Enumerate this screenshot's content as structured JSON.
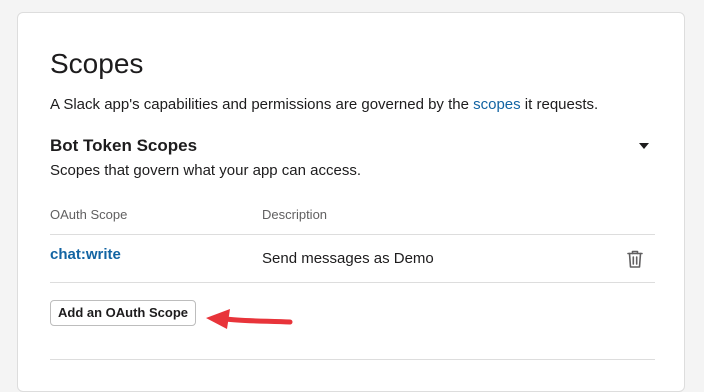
{
  "page": {
    "title": "Scopes",
    "intro_prefix": "A Slack app's capabilities and permissions are governed by the ",
    "intro_link": "scopes",
    "intro_suffix": " it requests."
  },
  "bot_scopes": {
    "title": "Bot Token Scopes",
    "description": "Scopes that govern what your app can access.",
    "toggle_icon": "caret-down-icon",
    "columns": [
      "OAuth Scope",
      "Description"
    ],
    "rows": [
      {
        "scope": "chat:write",
        "description": "Send messages as Demo",
        "action_icon": "trash-icon"
      }
    ],
    "add_button_label": "Add an OAuth Scope"
  },
  "annotation": {
    "icon": "red-arrow-icon",
    "color": "#e8343a"
  },
  "colors": {
    "link": "#1264a3",
    "text": "#1d1c1d",
    "muted": "#616061",
    "border": "#dddddd",
    "background": "#f4f4f4"
  }
}
